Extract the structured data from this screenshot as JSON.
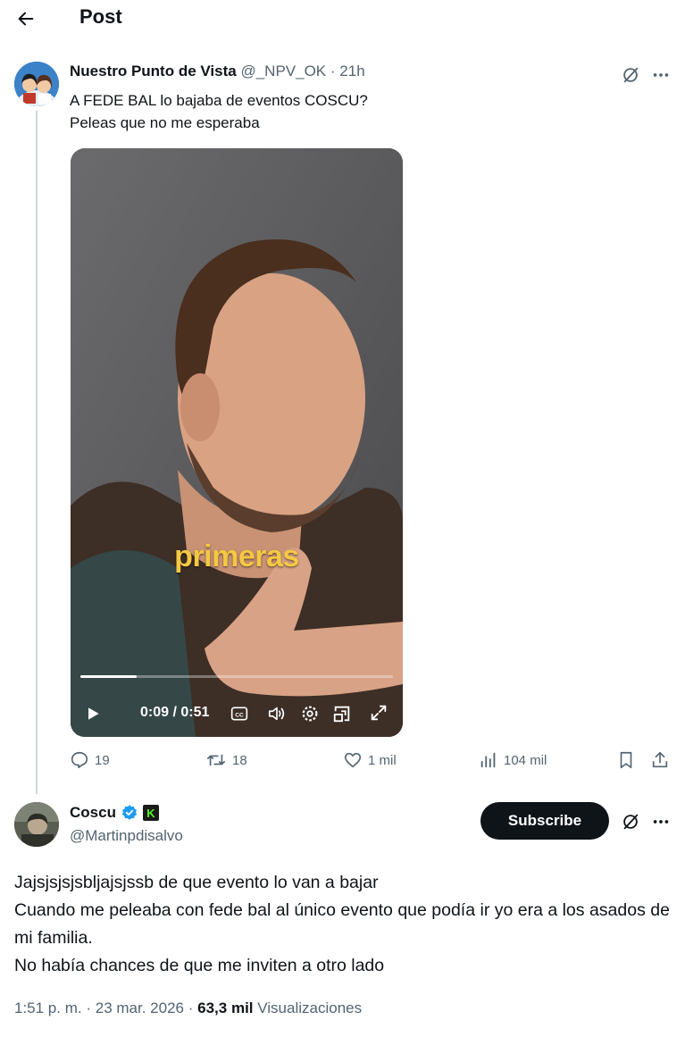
{
  "header": {
    "title": "Post"
  },
  "post": {
    "author_name": "Nuestro Punto de Vista",
    "handle": "@_NPV_OK",
    "time": "21h",
    "separator": "·",
    "text_lines": [
      "A FEDE BAL lo bajaba de eventos COSCU?",
      "Peleas que no me esperaba"
    ],
    "video": {
      "caption": "primeras",
      "time_display": "0:09 / 0:51",
      "progress": 0.18
    },
    "stats": {
      "replies": "19",
      "reposts": "18",
      "likes": "1 mil",
      "views": "104 mil"
    }
  },
  "reply": {
    "author_name": "Coscu",
    "handle": "@Martinpdisalvo",
    "badge_letter": "K",
    "subscribe_label": "Subscribe",
    "lines": [
      "Jajsjsjsjsbljajsjssb de que evento lo van a bajar",
      "Cuando me peleaba con fede bal al único evento que podía ir yo era a los asados de mi familia.",
      "No había chances de que me inviten a otro lado"
    ],
    "meta": {
      "time": "1:51 p. m.",
      "date": "23 mar. 2026",
      "sep": "·",
      "views_count": "63,3 mil",
      "views_label": "Visualizaciones"
    }
  },
  "colors": {
    "text": "#0f1419",
    "muted": "#536471",
    "verified": "#1d9bf0",
    "kick_green": "#53fc18",
    "caption_yellow": "#f4c842",
    "thread_line": "#cfd9de"
  },
  "icons": {
    "back": "arrow-left-icon",
    "grok": "grok-icon",
    "more": "more-horizontal-icon",
    "reply": "reply-icon",
    "repost": "repost-icon",
    "like": "heart-icon",
    "views": "bar-chart-icon",
    "bookmark": "bookmark-icon",
    "share": "share-icon"
  }
}
